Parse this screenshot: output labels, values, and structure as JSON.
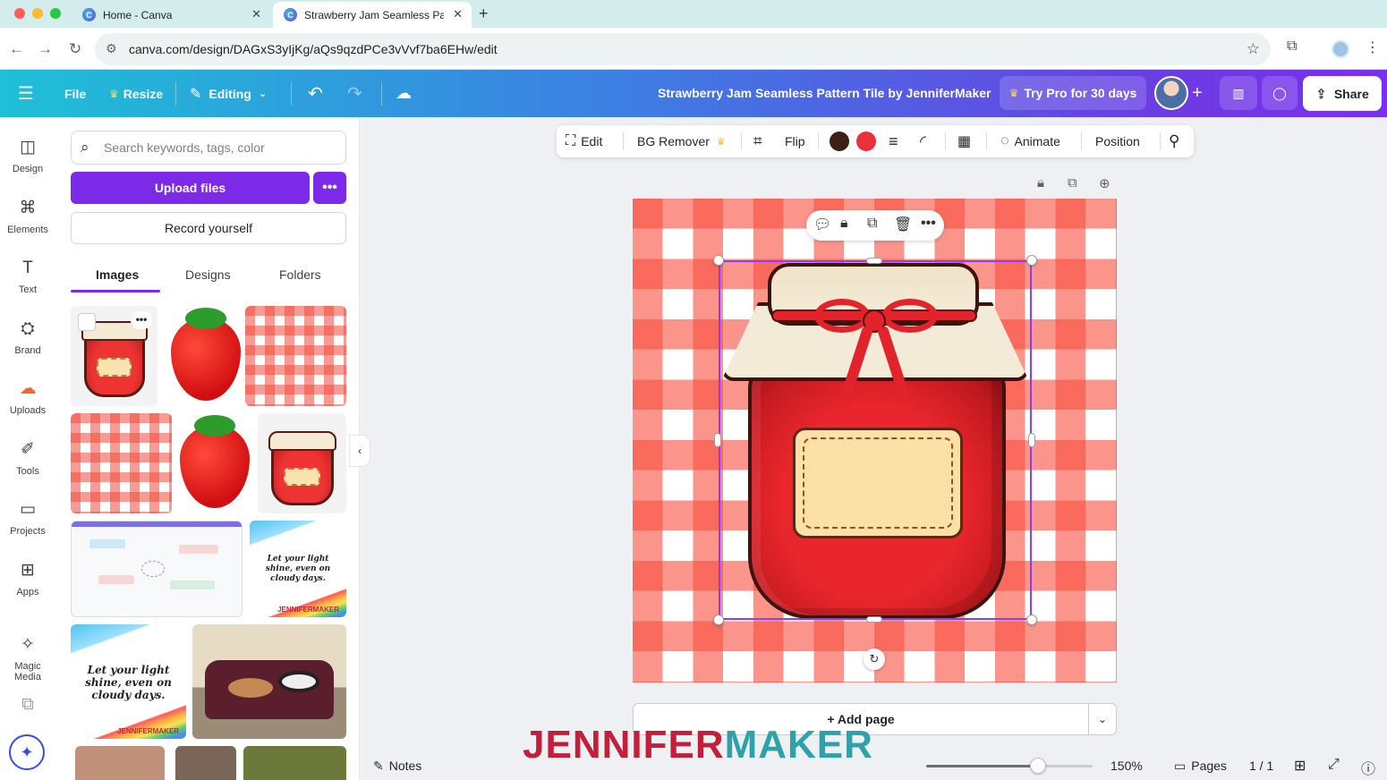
{
  "browser": {
    "tabs": [
      {
        "title": "Home - Canva",
        "active": false
      },
      {
        "title": "Strawberry Jam Seamless Pattern",
        "active": true
      }
    ],
    "url": "canva.com/design/DAGxS3yIjKg/aQs9qzdPCe3vVvf7ba6EHw/edit"
  },
  "header": {
    "file": "File",
    "resize": "Resize",
    "editing": "Editing",
    "doc_title": "Strawberry Jam Seamless Pattern Tile by JenniferMaker",
    "try_pro": "Try Pro for 30 days",
    "share": "Share"
  },
  "rail": {
    "items": [
      {
        "label": "Design",
        "icon": "design-icon"
      },
      {
        "label": "Elements",
        "icon": "elements-icon"
      },
      {
        "label": "Text",
        "icon": "text-icon"
      },
      {
        "label": "Brand",
        "icon": "brand-icon"
      },
      {
        "label": "Uploads",
        "icon": "uploads-icon"
      },
      {
        "label": "Tools",
        "icon": "tools-icon"
      },
      {
        "label": "Projects",
        "icon": "projects-icon"
      },
      {
        "label": "Apps",
        "icon": "apps-icon"
      },
      {
        "label": "Magic Media",
        "icon": "magic-media-icon"
      }
    ]
  },
  "panel": {
    "search_placeholder": "Search keywords, tags, color",
    "upload_label": "Upload files",
    "upload_more": "•••",
    "record_label": "Record yourself",
    "tabs": [
      "Images",
      "Designs",
      "Folders"
    ],
    "active_tab": "Images",
    "thumb_text_small": "Let your light shine, even on cloudy days.",
    "thumb_brand": "JENNIFERMAKER"
  },
  "context_toolbar": {
    "edit": "Edit",
    "bg_remover": "BG Remover",
    "flip": "Flip",
    "animate": "Animate",
    "position": "Position",
    "colors": [
      "#3d1f14",
      "#e8313a"
    ]
  },
  "canvas": {
    "add_page": "+ Add page"
  },
  "footer": {
    "notes": "Notes",
    "zoom": "150%",
    "zoom_fraction": 0.67,
    "pages": "Pages",
    "page_count": "1 / 1"
  },
  "watermark": {
    "part1": "JENNIFER",
    "part2": "MAKER"
  },
  "colors": {
    "accent": "#7d2ae8",
    "gingham": "#f84e3e",
    "jar_red": "#e8262c"
  }
}
